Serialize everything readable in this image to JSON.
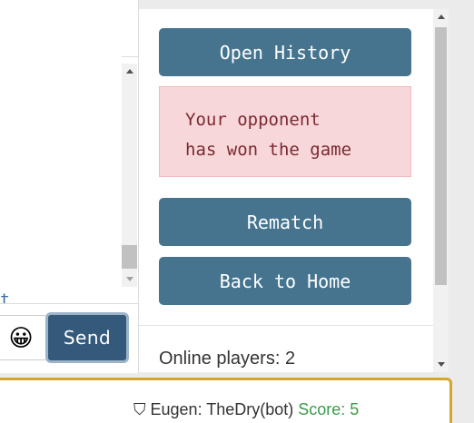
{
  "chat": {
    "truncated_text": "t",
    "emoji": "😀",
    "send_label": "Send"
  },
  "game": {
    "open_history_label": "Open History",
    "alert_line1": "Your opponent",
    "alert_line2": "has won the game",
    "rematch_label": "Rematch",
    "back_home_label": "Back to Home",
    "online_players": "Online players: 2"
  },
  "footer": {
    "shield": "⛉",
    "players_text": "Eugen: TheDry(bot)",
    "score_text": "Score: 5"
  },
  "colors": {
    "button": "#46748f",
    "send": "#34597a",
    "alert_bg": "#f8d7da",
    "footer_border": "#d4a62a"
  }
}
